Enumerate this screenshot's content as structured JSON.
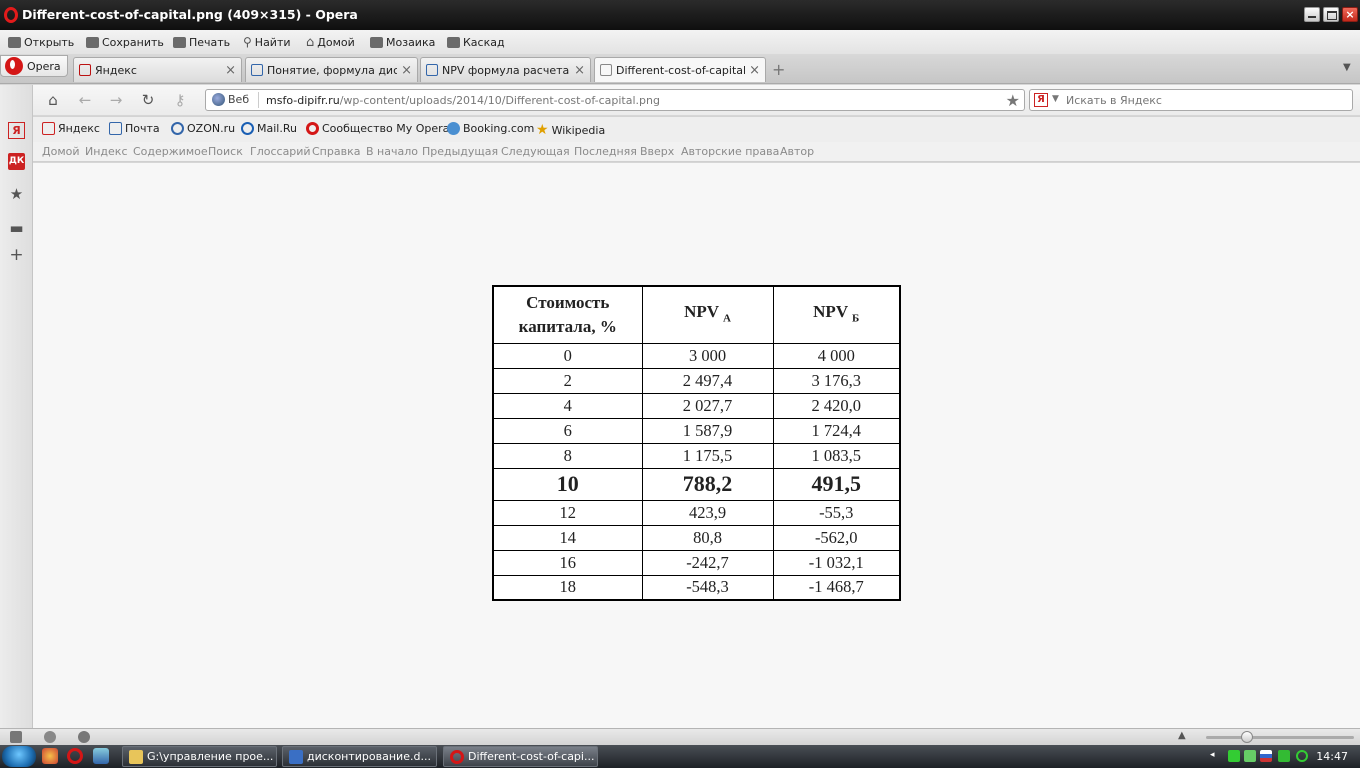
{
  "window": {
    "title": "Different-cost-of-capital.png (409×315) - Opera"
  },
  "menu": {
    "open": "Открыть",
    "save": "Сохранить",
    "print": "Печать",
    "find": "Найти",
    "home": "Домой",
    "tile": "Мозаика",
    "cascade": "Каскад"
  },
  "opera_button": "Opera",
  "tabs": [
    {
      "label": "Яндекс"
    },
    {
      "label": "Понятие, формула дис..."
    },
    {
      "label": "NPV формула расчета п..."
    },
    {
      "label": "Different-cost-of-capital...."
    }
  ],
  "address": {
    "web_label": "Веб",
    "url_host": "msfo-dipifr.ru",
    "url_path": "/wp-content/uploads/2014/10/Different-cost-of-capital.png",
    "search_placeholder": "Искать в Яндекс"
  },
  "bookmarks": [
    "Яндекс",
    "Почта",
    "OZON.ru",
    "Mail.Ru",
    "Сообщество My Opera",
    "Booking.com",
    "Wikipedia"
  ],
  "nav_links": [
    "Домой",
    "Индекс",
    "Содержимое",
    "Поиск",
    "Глоссарий",
    "Справка",
    "В начало",
    "Предыдущая",
    "Следующая",
    "Последняя",
    "Вверх",
    "Авторские права",
    "Автор"
  ],
  "table": {
    "header_cost_line1": "Стоимость",
    "header_cost_line2": "капитала, %",
    "header_npv": "NPV",
    "sub_a": "А",
    "sub_b": "Б",
    "rows": [
      {
        "rate": "0",
        "a": "3 000",
        "b": "4 000"
      },
      {
        "rate": "2",
        "a": "2 497,4",
        "b": "3 176,3"
      },
      {
        "rate": "4",
        "a": "2 027,7",
        "b": "2 420,0"
      },
      {
        "rate": "6",
        "a": "1 587,9",
        "b": "1 724,4"
      },
      {
        "rate": "8",
        "a": "1 175,5",
        "b": "1 083,5"
      },
      {
        "rate": "10",
        "a": "788,2",
        "b": "491,5"
      },
      {
        "rate": "12",
        "a": "423,9",
        "b": "-55,3"
      },
      {
        "rate": "14",
        "a": "80,8",
        "b": "-562,0"
      },
      {
        "rate": "16",
        "a": "-242,7",
        "b": "-1 032,1"
      },
      {
        "rate": "18",
        "a": "-548,3",
        "b": "-1 468,7"
      }
    ]
  },
  "taskbar": {
    "items": [
      {
        "label": "G:\\управление прое..."
      },
      {
        "label": "дисконтирование.d..."
      },
      {
        "label": "Different-cost-of-capi..."
      }
    ],
    "clock": "14:47"
  }
}
